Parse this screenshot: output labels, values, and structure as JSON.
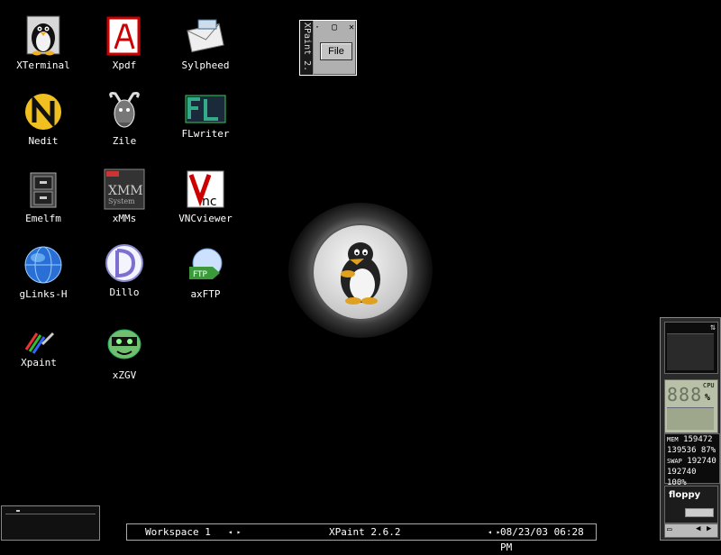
{
  "desktop": {
    "icons": [
      {
        "label": "XTerminal"
      },
      {
        "label": "Xpdf"
      },
      {
        "label": "Sylpheed"
      },
      {
        "label": "Nedit"
      },
      {
        "label": "Zile"
      },
      {
        "label": "FLwriter"
      },
      {
        "label": "Emelfm"
      },
      {
        "label": "xMMs"
      },
      {
        "label": "VNCviewer"
      },
      {
        "label": "gLinks-H"
      },
      {
        "label": "Dillo"
      },
      {
        "label": "axFTP"
      },
      {
        "label": "Xpaint"
      },
      {
        "label": "xZGV"
      }
    ]
  },
  "xpaint_window": {
    "title": "XPaint 2.",
    "file_button": "File"
  },
  "dock": {
    "cpu_label": "CPU",
    "cpu_value": "888",
    "cpu_percent_symbol": "%",
    "mem_label": "MEM",
    "mem_value": "159472",
    "mem_line2": "139536 87%",
    "swap_label": "SWAP",
    "swap_value": "192740",
    "swap_line2": "192740 100%",
    "floppy_label": "floppy"
  },
  "taskbar": {
    "workspace": "Workspace 1",
    "active_window": "XPaint 2.6.2",
    "datetime": "08/23/03 06:28 PM"
  },
  "colors": {
    "background": "#000000",
    "panel_border": "#aaaaaa"
  }
}
